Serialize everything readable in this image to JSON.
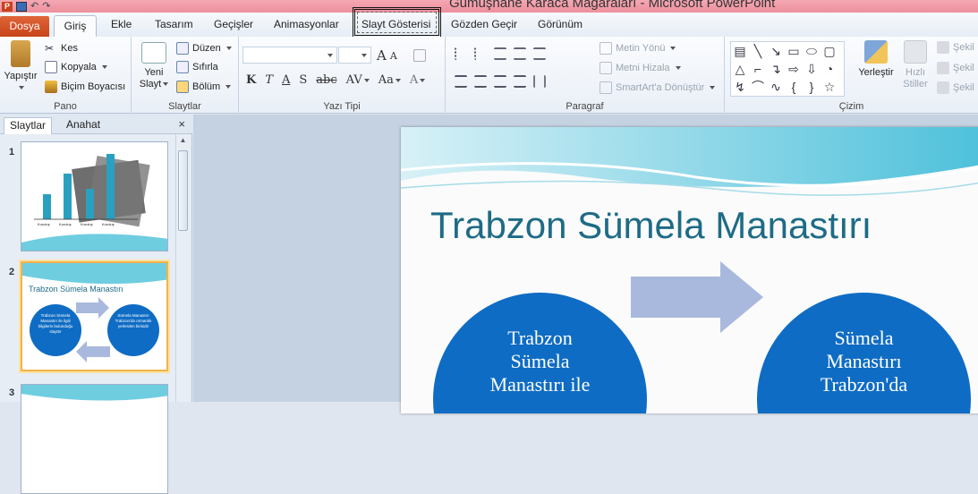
{
  "window": {
    "title": "Gümüşhane Karaca Mağaraları  -  Microsoft PowerPoint"
  },
  "ribbon_tabs": {
    "file": "Dosya",
    "home": "Giriş",
    "insert": "Ekle",
    "design": "Tasarım",
    "transitions": "Geçişler",
    "animations": "Animasyonlar",
    "slideshow": "Slayt Gösterisi",
    "review": "Gözden Geçir",
    "view": "Görünüm"
  },
  "clipboard": {
    "paste": "Yapıştır",
    "cut": "Kes",
    "copy": "Kopyala",
    "format_painter": "Biçim Boyacısı",
    "label": "Pano"
  },
  "slides_group": {
    "new_slide_1": "Yeni",
    "new_slide_2": "Slayt",
    "layout": "Düzen",
    "reset": "Sıfırla",
    "section": "Bölüm",
    "label": "Slaytlar"
  },
  "font": {
    "bold": "K",
    "italic": "T",
    "underline": "A",
    "shadow": "S",
    "strike": "abc",
    "spacing": "AV",
    "case": "Aa",
    "color": "A",
    "grow": "A",
    "shrink": "A",
    "label": "Yazı Tipi"
  },
  "paragraph": {
    "text_direction": "Metin Yönü",
    "align_text": "Metni Hizala",
    "smartart": "SmartArt'a Dönüştür",
    "label": "Paragraf"
  },
  "drawing": {
    "arrange": "Yerleştir",
    "quick_styles_1": "Hızlı",
    "quick_styles_2": "Stiller",
    "shape_fill": "Şekil",
    "shape_outline": "Şekil",
    "shape_effects": "Şekil",
    "label": "Çizim"
  },
  "pane": {
    "slides_tab": "Slaytlar",
    "outline_tab": "Anahat",
    "close": "×"
  },
  "thumbnails": [
    {
      "number": "1",
      "bar_labels": [
        "Kuruluş",
        "Kuruluş",
        "Kuruluş",
        "Kuruluş"
      ]
    },
    {
      "number": "2",
      "title": "Trabzon Sümela Manastırı",
      "circle1": "Trabzon Sümela Manastırı ile ilgili bilgilerin bulunduğu slayttır",
      "circle2": "Sümela Manastırı Trabzon'da ormanlık yerlerden birisidir"
    },
    {
      "number": "3"
    }
  ],
  "slide": {
    "title": "Trabzon Sümela Manastırı",
    "circle_left": "Trabzon Sümela Manastırı ile",
    "circle_right": "Sümela Manastırı Trabzon'da"
  },
  "colors": {
    "accent_blue": "#0f6cc4",
    "title_teal": "#1e6b86",
    "arrow": "#a9b9dd",
    "file_tab": "#d2542a"
  }
}
